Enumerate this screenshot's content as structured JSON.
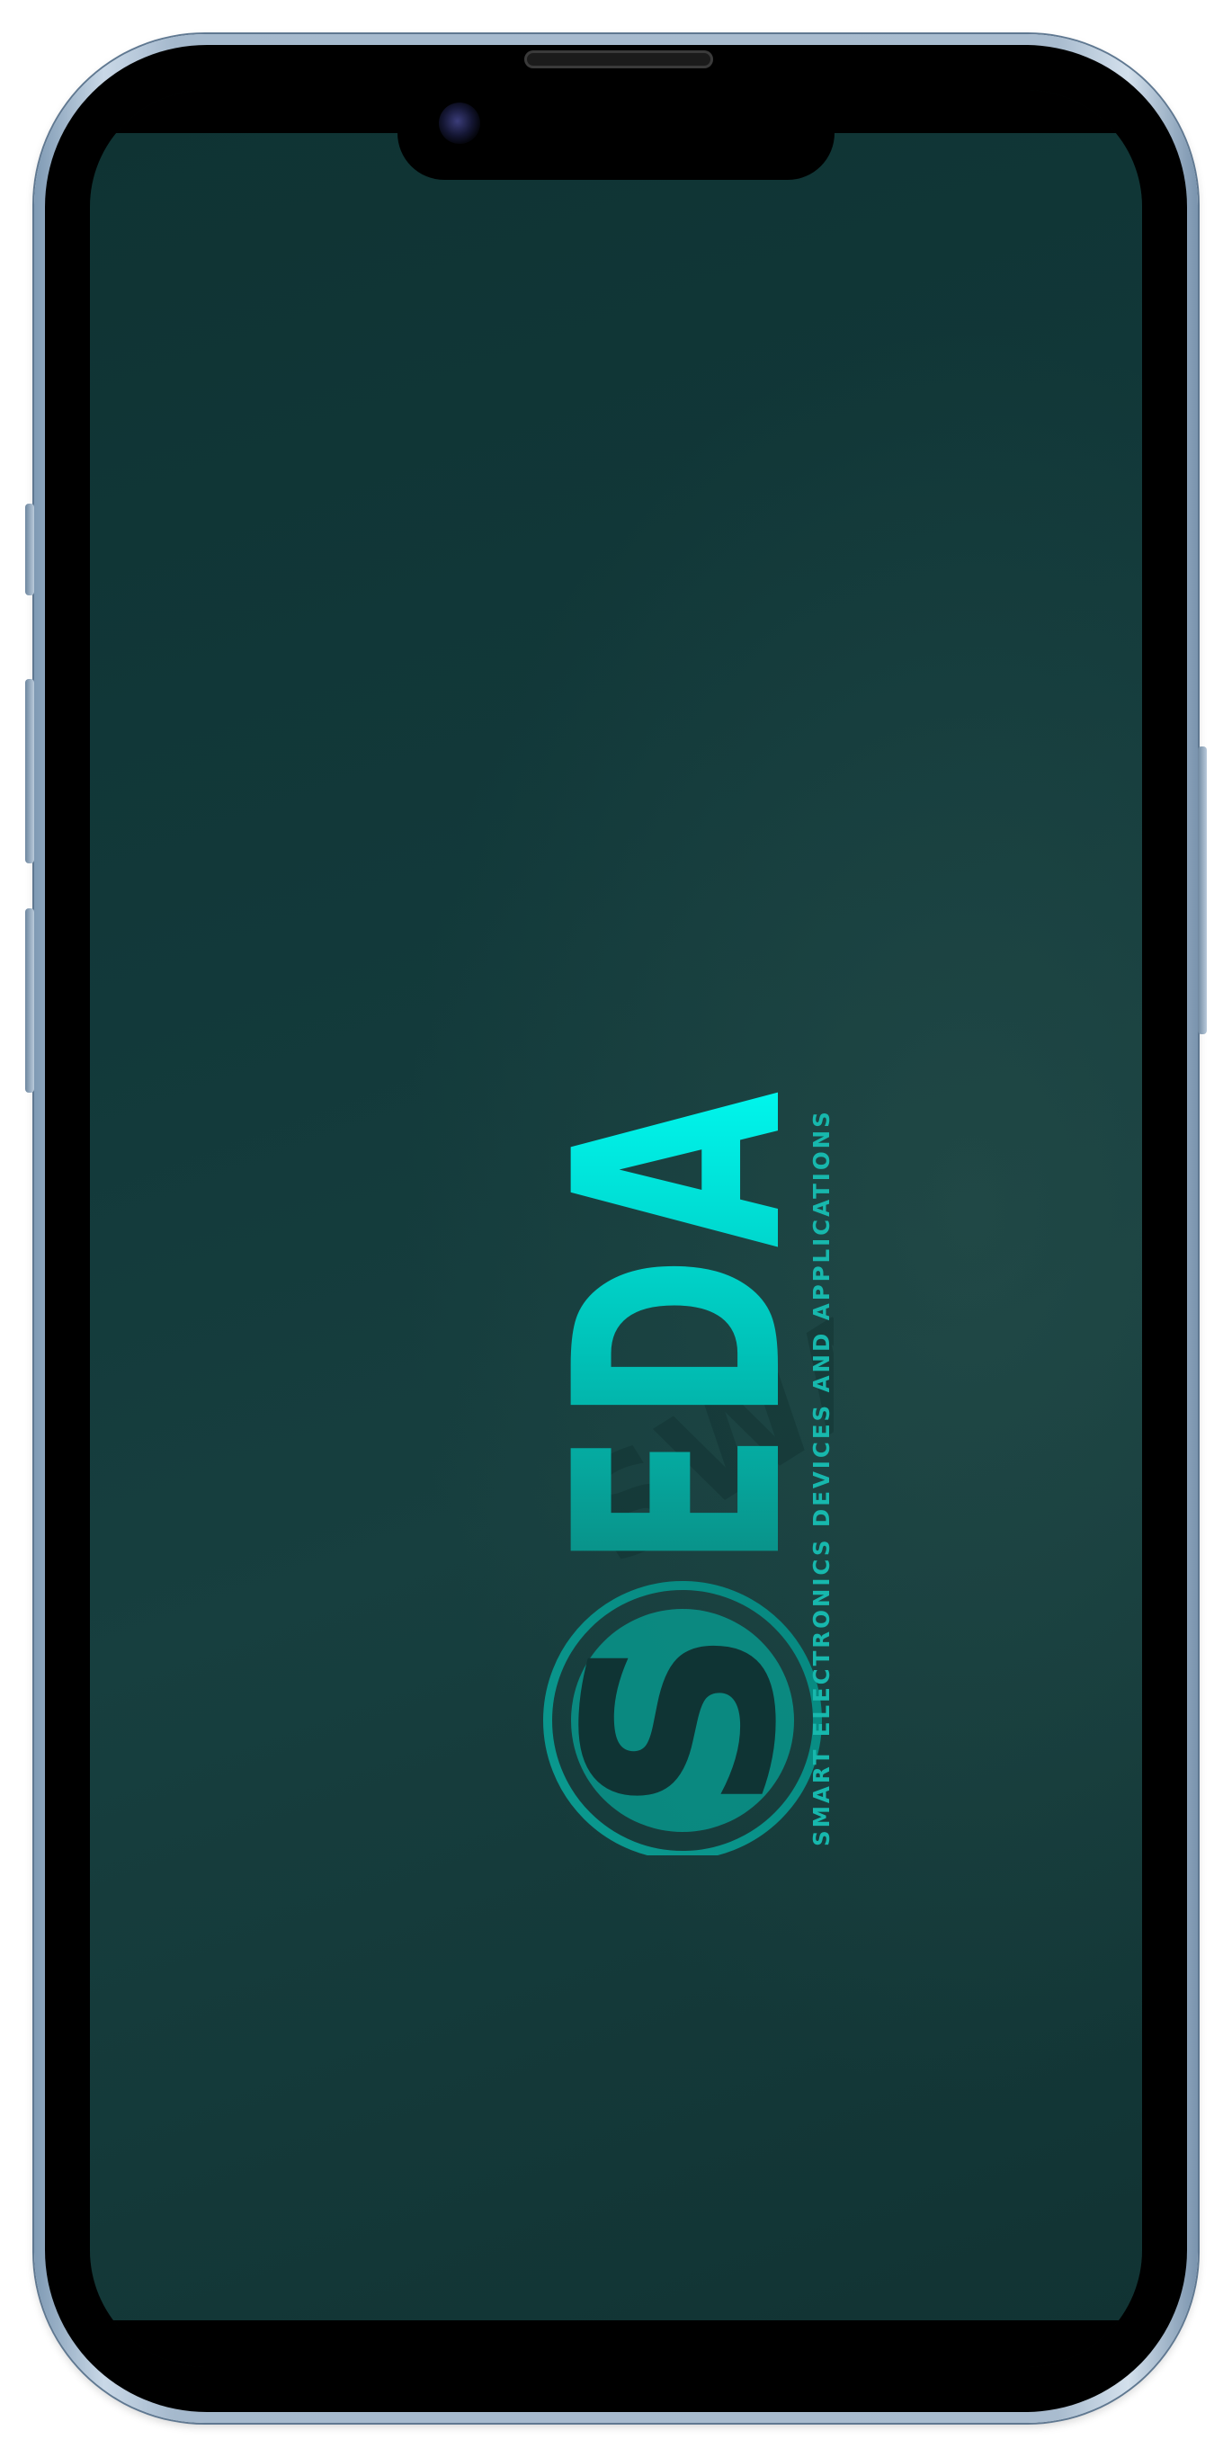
{
  "device": {
    "model_icon": "smartphone-frame",
    "frame_color": "#a9bccf"
  },
  "splash": {
    "brand_initial": "S",
    "brand_name": "EDA",
    "tagline": "SMART ELECTRONICS DEVICES AND APPLICATIONS",
    "logo_icon": "circled-s-icon",
    "watermark_text": "SWAVRMS",
    "colors": {
      "background_dark": "#0f3333",
      "background_light": "#1f4947",
      "brand_bright": "#00f4ec",
      "brand_mid": "#00c2b8",
      "brand_deep": "#0a8f86",
      "tagline": "#17b8ad"
    }
  }
}
